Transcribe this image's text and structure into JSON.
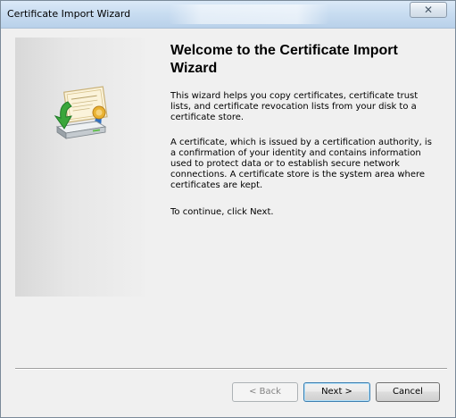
{
  "window": {
    "title": "Certificate Import Wizard",
    "close_label": "✕"
  },
  "main": {
    "heading": "Welcome to the Certificate Import Wizard",
    "paragraphs": [
      "This wizard helps you copy certificates, certificate trust lists, and certificate revocation lists from your disk to a certificate store.",
      "A certificate, which is issued by a certification authority, is a confirmation of your identity and contains information used to protect data or to establish secure network connections. A certificate store is the system area where certificates are kept.",
      "To continue, click Next."
    ]
  },
  "buttons": {
    "back": "< Back",
    "next": "Next >",
    "cancel": "Cancel"
  },
  "icons": {
    "wizard_icon": "certificate-import-icon"
  }
}
